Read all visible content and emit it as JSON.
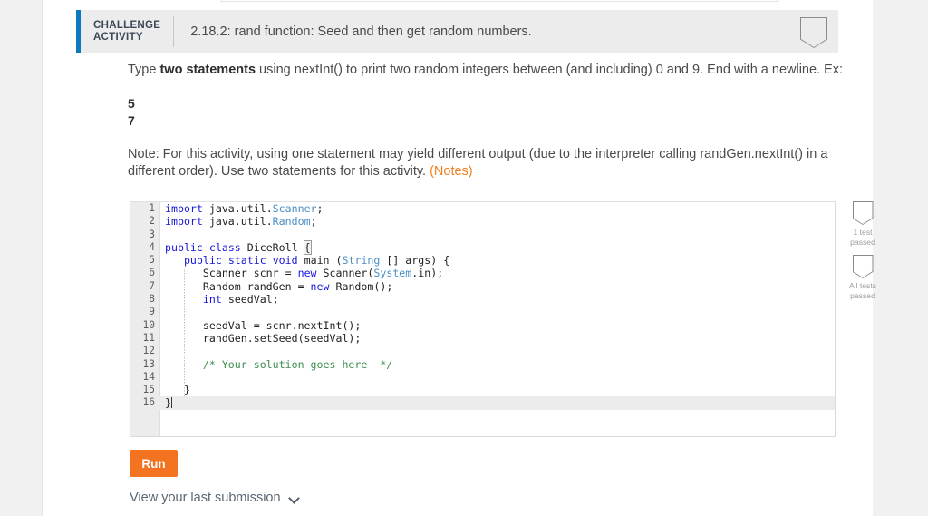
{
  "activity": {
    "kind_label_line1": "CHALLENGE",
    "kind_label_line2": "ACTIVITY",
    "title": "2.18.2: rand function: Seed and then get random numbers.",
    "accent_color": "#0c79bf",
    "header_bg": "#ececec",
    "header_badge_icon": "pennant-badge-icon"
  },
  "instructions": {
    "line1_prefix": "Type ",
    "line1_strong": "two statements",
    "line1_suffix": " using nextInt() to print two random integers between (and including) 0 and 9. End with a newline. Ex:",
    "example_line1": "5",
    "example_line2": "7",
    "note_text": "Note: For this activity, using one statement may yield different output (due to the interpreter calling randGen.nextInt() in a different order). Use two statements for this activity. ",
    "note_link": "(Notes)",
    "note_link_color": "#ef8022"
  },
  "editor": {
    "language": "java",
    "active_line": 16,
    "lines": [
      {
        "n": "1",
        "text": "import java.util.Scanner;"
      },
      {
        "n": "2",
        "text": "import java.util.Random;"
      },
      {
        "n": "3",
        "text": ""
      },
      {
        "n": "4",
        "text": "public class DiceRoll {"
      },
      {
        "n": "5",
        "text": "   public static void main (String [] args) {"
      },
      {
        "n": "6",
        "text": "      Scanner scnr = new Scanner(System.in);"
      },
      {
        "n": "7",
        "text": "      Random randGen = new Random();"
      },
      {
        "n": "8",
        "text": "      int seedVal;"
      },
      {
        "n": "9",
        "text": ""
      },
      {
        "n": "10",
        "text": "      seedVal = scnr.nextInt();"
      },
      {
        "n": "11",
        "text": "      randGen.setSeed(seedVal);"
      },
      {
        "n": "12",
        "text": ""
      },
      {
        "n": "13",
        "text": "      /* Your solution goes here  */"
      },
      {
        "n": "14",
        "text": ""
      },
      {
        "n": "15",
        "text": "   }"
      },
      {
        "n": "16",
        "text": "}"
      }
    ],
    "colors": {
      "keyword": "#1717d4",
      "type": "#4b8ec4",
      "comment": "#3d8f4e",
      "text": "#222222",
      "gutter_bg": "#ececec",
      "active_line_bg": "#ececec"
    }
  },
  "tests": [
    {
      "icon": "pennant-badge-icon",
      "caption_line1": "1 test",
      "caption_line2": "passed"
    },
    {
      "icon": "pennant-badge-icon",
      "caption_line1": "All tests",
      "caption_line2": "passed"
    }
  ],
  "footer": {
    "run_label": "Run",
    "run_color": "#f37321",
    "last_submission_label": "View your last submission",
    "chevron_icon": "chevron-down-icon"
  }
}
